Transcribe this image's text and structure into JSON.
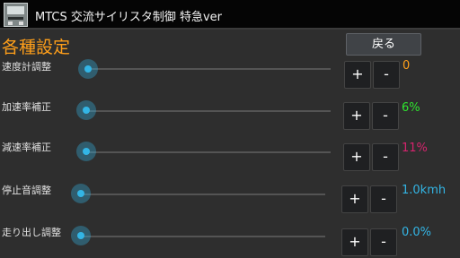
{
  "header": {
    "title": "MTCS 交流サイリスタ制御 特急ver"
  },
  "page": {
    "heading": "各種設定",
    "back_label": "戻る"
  },
  "settings": [
    {
      "label": "速度計調整",
      "value": "0",
      "value_color": "#ff9f1a",
      "level": 0
    },
    {
      "label": "加速率補正",
      "value": "6%",
      "value_color": "#2ee62e",
      "level": 0
    },
    {
      "label": "減速率補正",
      "value": "11%",
      "value_color": "#d6246e",
      "level": 0
    },
    {
      "label": "停止音調整",
      "value": "1.0kmh",
      "value_color": "#33b5e5",
      "level": 0
    },
    {
      "label": "走り出し調整",
      "value": "0.0%",
      "value_color": "#33b5e5",
      "level": 0
    }
  ],
  "controls": {
    "plus": "+",
    "minus": "-"
  },
  "colors": {
    "accent": "#33b5e5",
    "heading": "#ff9f1a"
  },
  "icons": {
    "app": "train-panel-icon"
  }
}
